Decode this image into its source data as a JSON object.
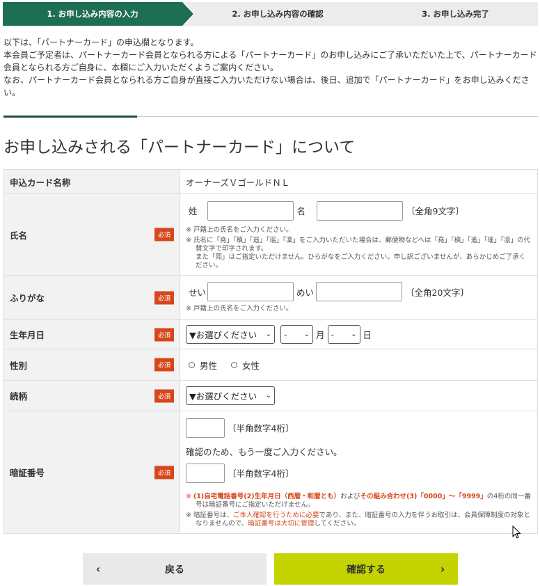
{
  "steps": [
    {
      "label": "1. お申し込み内容の入力",
      "active": true
    },
    {
      "label": "2. お申し込み内容の確認",
      "active": false
    },
    {
      "label": "3. お申し込み完了",
      "active": false
    }
  ],
  "intro": {
    "line1": "以下は、「パートナーカード」の申込欄となります。",
    "line2": "本会員ご予定者は、パートナーカード会員となられる方による「パートナーカード」のお申し込みにご了承いただいた上で、パートナーカード会員となられる方ご自身に、本欄にご入力いただくようご案内ください。",
    "line3": "なお、パートナーカード会員となられる方ご自身が直接ご入力いただけない場合は、後日、追加で「パートナーカード」をお申し込みください。"
  },
  "section_title": "お申し込みされる「パートナーカード」について",
  "required_badge": "必須",
  "card_name": {
    "label": "申込カード名称",
    "value": "オーナーズＶゴールドＮＬ"
  },
  "name": {
    "label": "氏名",
    "sei_label": "姓",
    "mei_label": "名",
    "sei_value": "",
    "mei_value": "",
    "limit": "〔全角9文字〕",
    "note1": "※ 戸籍上の氏名をご入力ください。",
    "note2": "※ 氏名に「尭」「槙」「遥」「瑶」「凜」をご入力いただいた場合は、郵便物などへは「堯」「槇」「遙」「瑤」「凛」の代替文字で印字されます。",
    "note3": "また「煕」はご指定いただけません。ひらがなをご入力ください。申し訳ございませんが、あらかじめご了承ください。"
  },
  "furigana": {
    "label": "ふりがな",
    "sei_label": "せい",
    "mei_label": "めい",
    "sei_value": "",
    "mei_value": "",
    "limit": "〔全角20文字〕",
    "note": "※ 戸籍上の氏名をご入力ください。"
  },
  "birthdate": {
    "label": "生年月日",
    "year_selected": "▼お選びください",
    "month_selected": "-",
    "month_label": "月",
    "day_selected": "-",
    "day_label": "日"
  },
  "gender": {
    "label": "性別",
    "options": [
      "男性",
      "女性"
    ]
  },
  "relation": {
    "label": "続柄",
    "selected": "▼お選びください"
  },
  "pin": {
    "label": "暗証番号",
    "value1": "",
    "value2": "",
    "limit": "〔半角数字4桁〕",
    "confirm_text": "確認のため、もう一度ご入力ください。",
    "note1_a": "※ ",
    "note1_b": "(1)自宅電話番号(2)生年月日（西暦・和暦とも）",
    "note1_c": "および",
    "note1_d": "その組み合わせ(3)「0000」〜「9999」",
    "note1_e": "の4桁の同一番号は暗証番号にご指定いただけません。",
    "note2_a": "※ 暗証番号は、",
    "note2_b": "ご本人確認を行うために必要",
    "note2_c": "であり、また、暗証番号の入力を伴うお取引は、会員保障制度の対象となりませんので、",
    "note2_d": "暗証番号は大切に管理",
    "note2_e": "してください。"
  },
  "buttons": {
    "back": "戻る",
    "next": "確認する"
  },
  "colors": {
    "primary": "#1d6e53",
    "required": "#d7461b",
    "confirm": "#c5d400"
  }
}
